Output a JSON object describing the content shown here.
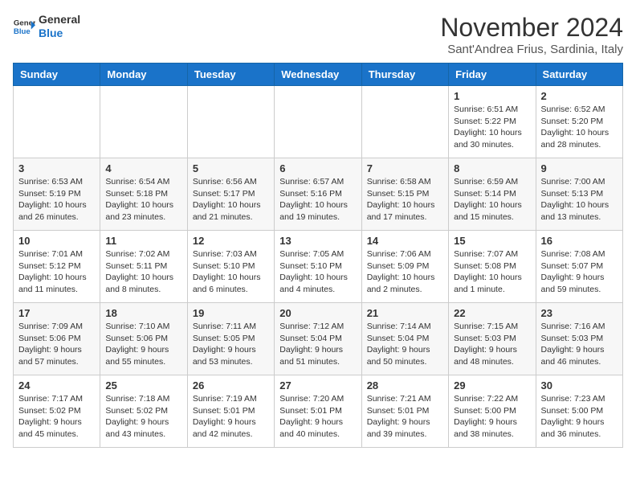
{
  "header": {
    "logo_general": "General",
    "logo_blue": "Blue",
    "month_title": "November 2024",
    "location": "Sant'Andrea Frius, Sardinia, Italy"
  },
  "weekdays": [
    "Sunday",
    "Monday",
    "Tuesday",
    "Wednesday",
    "Thursday",
    "Friday",
    "Saturday"
  ],
  "weeks": [
    [
      {
        "day": "",
        "info": ""
      },
      {
        "day": "",
        "info": ""
      },
      {
        "day": "",
        "info": ""
      },
      {
        "day": "",
        "info": ""
      },
      {
        "day": "",
        "info": ""
      },
      {
        "day": "1",
        "info": "Sunrise: 6:51 AM\nSunset: 5:22 PM\nDaylight: 10 hours and 30 minutes."
      },
      {
        "day": "2",
        "info": "Sunrise: 6:52 AM\nSunset: 5:20 PM\nDaylight: 10 hours and 28 minutes."
      }
    ],
    [
      {
        "day": "3",
        "info": "Sunrise: 6:53 AM\nSunset: 5:19 PM\nDaylight: 10 hours and 26 minutes."
      },
      {
        "day": "4",
        "info": "Sunrise: 6:54 AM\nSunset: 5:18 PM\nDaylight: 10 hours and 23 minutes."
      },
      {
        "day": "5",
        "info": "Sunrise: 6:56 AM\nSunset: 5:17 PM\nDaylight: 10 hours and 21 minutes."
      },
      {
        "day": "6",
        "info": "Sunrise: 6:57 AM\nSunset: 5:16 PM\nDaylight: 10 hours and 19 minutes."
      },
      {
        "day": "7",
        "info": "Sunrise: 6:58 AM\nSunset: 5:15 PM\nDaylight: 10 hours and 17 minutes."
      },
      {
        "day": "8",
        "info": "Sunrise: 6:59 AM\nSunset: 5:14 PM\nDaylight: 10 hours and 15 minutes."
      },
      {
        "day": "9",
        "info": "Sunrise: 7:00 AM\nSunset: 5:13 PM\nDaylight: 10 hours and 13 minutes."
      }
    ],
    [
      {
        "day": "10",
        "info": "Sunrise: 7:01 AM\nSunset: 5:12 PM\nDaylight: 10 hours and 11 minutes."
      },
      {
        "day": "11",
        "info": "Sunrise: 7:02 AM\nSunset: 5:11 PM\nDaylight: 10 hours and 8 minutes."
      },
      {
        "day": "12",
        "info": "Sunrise: 7:03 AM\nSunset: 5:10 PM\nDaylight: 10 hours and 6 minutes."
      },
      {
        "day": "13",
        "info": "Sunrise: 7:05 AM\nSunset: 5:10 PM\nDaylight: 10 hours and 4 minutes."
      },
      {
        "day": "14",
        "info": "Sunrise: 7:06 AM\nSunset: 5:09 PM\nDaylight: 10 hours and 2 minutes."
      },
      {
        "day": "15",
        "info": "Sunrise: 7:07 AM\nSunset: 5:08 PM\nDaylight: 10 hours and 1 minute."
      },
      {
        "day": "16",
        "info": "Sunrise: 7:08 AM\nSunset: 5:07 PM\nDaylight: 9 hours and 59 minutes."
      }
    ],
    [
      {
        "day": "17",
        "info": "Sunrise: 7:09 AM\nSunset: 5:06 PM\nDaylight: 9 hours and 57 minutes."
      },
      {
        "day": "18",
        "info": "Sunrise: 7:10 AM\nSunset: 5:06 PM\nDaylight: 9 hours and 55 minutes."
      },
      {
        "day": "19",
        "info": "Sunrise: 7:11 AM\nSunset: 5:05 PM\nDaylight: 9 hours and 53 minutes."
      },
      {
        "day": "20",
        "info": "Sunrise: 7:12 AM\nSunset: 5:04 PM\nDaylight: 9 hours and 51 minutes."
      },
      {
        "day": "21",
        "info": "Sunrise: 7:14 AM\nSunset: 5:04 PM\nDaylight: 9 hours and 50 minutes."
      },
      {
        "day": "22",
        "info": "Sunrise: 7:15 AM\nSunset: 5:03 PM\nDaylight: 9 hours and 48 minutes."
      },
      {
        "day": "23",
        "info": "Sunrise: 7:16 AM\nSunset: 5:03 PM\nDaylight: 9 hours and 46 minutes."
      }
    ],
    [
      {
        "day": "24",
        "info": "Sunrise: 7:17 AM\nSunset: 5:02 PM\nDaylight: 9 hours and 45 minutes."
      },
      {
        "day": "25",
        "info": "Sunrise: 7:18 AM\nSunset: 5:02 PM\nDaylight: 9 hours and 43 minutes."
      },
      {
        "day": "26",
        "info": "Sunrise: 7:19 AM\nSunset: 5:01 PM\nDaylight: 9 hours and 42 minutes."
      },
      {
        "day": "27",
        "info": "Sunrise: 7:20 AM\nSunset: 5:01 PM\nDaylight: 9 hours and 40 minutes."
      },
      {
        "day": "28",
        "info": "Sunrise: 7:21 AM\nSunset: 5:01 PM\nDaylight: 9 hours and 39 minutes."
      },
      {
        "day": "29",
        "info": "Sunrise: 7:22 AM\nSunset: 5:00 PM\nDaylight: 9 hours and 38 minutes."
      },
      {
        "day": "30",
        "info": "Sunrise: 7:23 AM\nSunset: 5:00 PM\nDaylight: 9 hours and 36 minutes."
      }
    ]
  ]
}
